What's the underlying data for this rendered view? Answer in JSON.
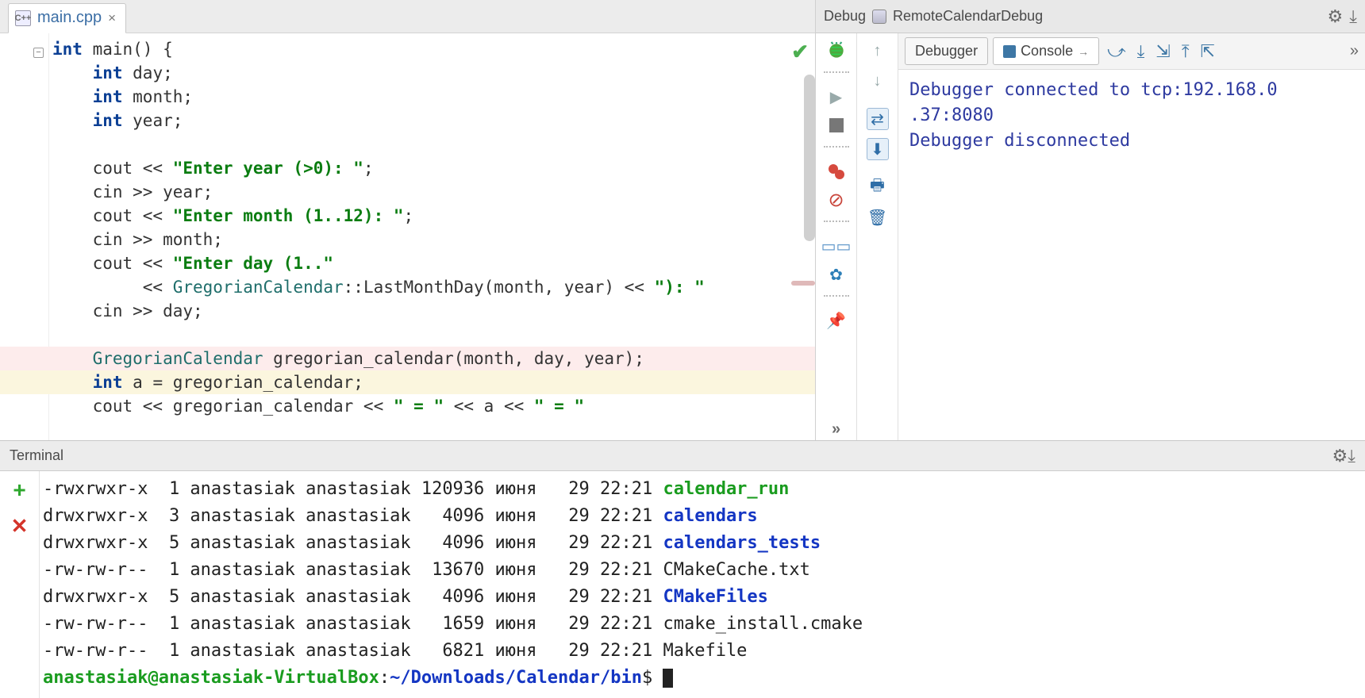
{
  "editor": {
    "filename": "main.cpp",
    "cpp_badge": "C++",
    "code_lines": [
      {
        "html": "<span class='kw'>int</span> main() {"
      },
      {
        "html": "    <span class='kw'>int</span> day;"
      },
      {
        "html": "    <span class='kw'>int</span> month;"
      },
      {
        "html": "    <span class='kw'>int</span> year;"
      },
      {
        "html": ""
      },
      {
        "html": "    cout &lt;&lt; <span class='str'>\"Enter year (&gt;0): \"</span>;"
      },
      {
        "html": "    cin &gt;&gt; year;"
      },
      {
        "html": "    cout &lt;&lt; <span class='str'>\"Enter month (1..12): \"</span>;"
      },
      {
        "html": "    cin &gt;&gt; month;"
      },
      {
        "html": "    cout &lt;&lt; <span class='str'>\"Enter day (1..\"</span>"
      },
      {
        "html": "         &lt;&lt; <span class='typ'>GregorianCalendar</span>::LastMonthDay(month, year) &lt;&lt; <span class='str'>\"): \"</span>"
      },
      {
        "html": "    cin &gt;&gt; day;"
      },
      {
        "html": ""
      },
      {
        "html": "    <span class='typ'>GregorianCalendar</span> gregorian_calendar(month, day, year);",
        "cls": "hl-err",
        "bp": true
      },
      {
        "html": "    <span class='kw'>int</span> a = gregorian_calendar;",
        "cls": "hl-warn"
      },
      {
        "html": "    cout &lt;&lt; gregorian_calendar &lt;&lt; <span class='str'>\" = \"</span> &lt;&lt; a &lt;&lt; <span class='str'>\" = \"</span>"
      }
    ]
  },
  "debug": {
    "title_prefix": "Debug",
    "config": "RemoteCalendarDebug",
    "tab_debugger": "Debugger",
    "tab_console": "Console",
    "console_lines": [
      "Debugger connected to tcp:192.168.0",
      " .37:8080",
      "Debugger disconnected"
    ]
  },
  "terminal": {
    "title": "Terminal",
    "rows": [
      {
        "perm": "-rwxrwxr-x",
        "n": "1",
        "own": "anastasiak",
        "grp": "anastasiak",
        "size": "120936",
        "mon": "июня",
        "day": "29",
        "time": "22:21",
        "name": "calendar_run",
        "cls": "exe"
      },
      {
        "perm": "drwxrwxr-x",
        "n": "3",
        "own": "anastasiak",
        "grp": "anastasiak",
        "size": "4096",
        "mon": "июня",
        "day": "29",
        "time": "22:21",
        "name": "calendars",
        "cls": "dir"
      },
      {
        "perm": "drwxrwxr-x",
        "n": "5",
        "own": "anastasiak",
        "grp": "anastasiak",
        "size": "4096",
        "mon": "июня",
        "day": "29",
        "time": "22:21",
        "name": "calendars_tests",
        "cls": "dir"
      },
      {
        "perm": "-rw-rw-r--",
        "n": "1",
        "own": "anastasiak",
        "grp": "anastasiak",
        "size": "13670",
        "mon": "июня",
        "day": "29",
        "time": "22:21",
        "name": "CMakeCache.txt",
        "cls": ""
      },
      {
        "perm": "drwxrwxr-x",
        "n": "5",
        "own": "anastasiak",
        "grp": "anastasiak",
        "size": "4096",
        "mon": "июня",
        "day": "29",
        "time": "22:21",
        "name": "CMakeFiles",
        "cls": "dir"
      },
      {
        "perm": "-rw-rw-r--",
        "n": "1",
        "own": "anastasiak",
        "grp": "anastasiak",
        "size": "1659",
        "mon": "июня",
        "day": "29",
        "time": "22:21",
        "name": "cmake_install.cmake",
        "cls": ""
      },
      {
        "perm": "-rw-rw-r--",
        "n": "1",
        "own": "anastasiak",
        "grp": "anastasiak",
        "size": "6821",
        "mon": "июня",
        "day": "29",
        "time": "22:21",
        "name": "Makefile",
        "cls": ""
      }
    ],
    "prompt_user": "anastasiak@anastasiak-VirtualBox",
    "prompt_sep": ":",
    "prompt_path": "~/Downloads/Calendar/bin",
    "prompt_end": "$ "
  }
}
